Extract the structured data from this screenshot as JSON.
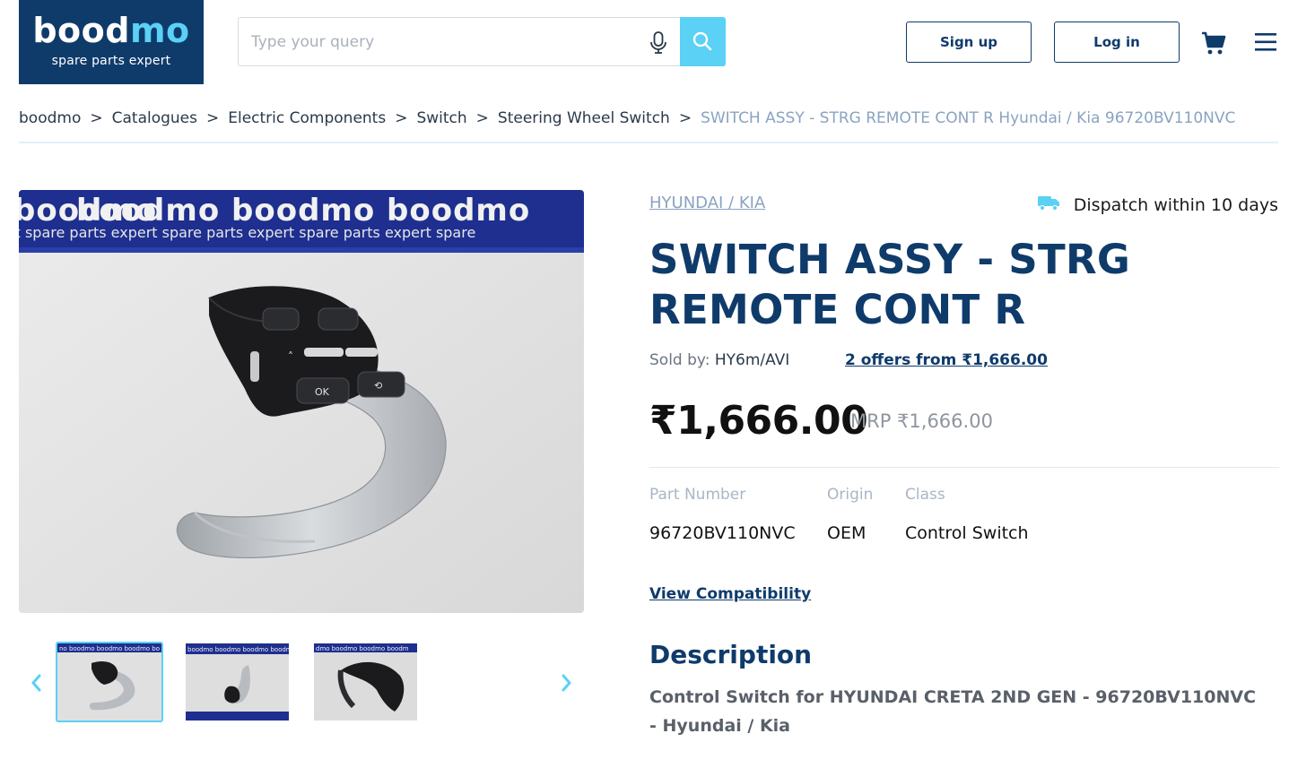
{
  "header": {
    "logo_word_1": "bood",
    "logo_word_2": "mo",
    "logo_tagline": "spare parts expert",
    "search_placeholder": "Type your query",
    "signup_label": "Sign up",
    "login_label": "Log in"
  },
  "breadcrumb": {
    "items": [
      "boodmo",
      "Catalogues",
      "Electric Components",
      "Switch",
      "Steering Wheel Switch"
    ],
    "separator": ">",
    "current": "SWITCH ASSY - STRG REMOTE CONT R Hyundai / Kia 96720BV110NVC"
  },
  "gallery": {
    "watermark_brand": "boodmo",
    "watermark_tag": "spare parts expert",
    "thumbnail_count": 3,
    "active_thumbnail": 1
  },
  "product": {
    "brand": "HYUNDAI / KIA",
    "dispatch": "Dispatch within 10 days",
    "title": "SWITCH ASSY - STRG REMOTE CONT R",
    "sold_by_label": "Sold by:",
    "seller": "HY6m/AVI",
    "offers_link": "2 offers from ₹1,666.00",
    "price": "₹1,666.00",
    "mrp": "MRP ₹1,666.00",
    "specs": {
      "part_number_label": "Part Number",
      "part_number": "96720BV110NVC",
      "origin_label": "Origin",
      "origin": "OEM",
      "class_label": "Class",
      "class": "Control Switch"
    },
    "compatibility_link": "View Compatibility",
    "description_title": "Description",
    "description": "Control Switch for HYUNDAI CRETA 2ND GEN - 96720BV110NVC - Hyundai / Kia"
  },
  "colors": {
    "brand_navy": "#0f3b6b",
    "accent_cyan": "#5ad1f5",
    "muted_link": "#8aa3c1"
  },
  "icons": [
    "microphone-icon",
    "search-icon",
    "cart-icon",
    "menu-icon",
    "truck-icon",
    "chevron-left-icon",
    "chevron-right-icon"
  ]
}
